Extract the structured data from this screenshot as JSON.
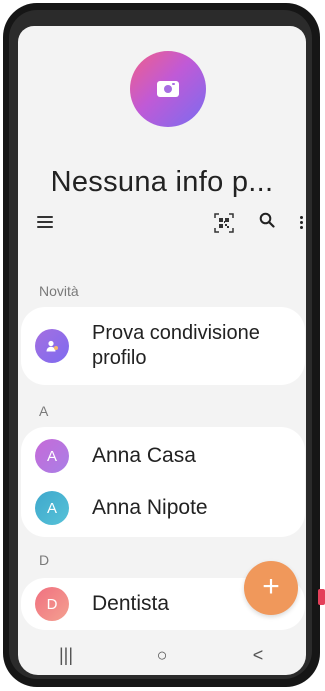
{
  "profile": {
    "title": "Nessuna info p..."
  },
  "toolbar": {
    "menu_icon": "menu-icon",
    "qr_icon": "qr-code-icon",
    "search_icon": "search-icon",
    "more_icon": "more-vertical-icon"
  },
  "sections": {
    "new": "Novità",
    "a": "A",
    "d": "D"
  },
  "share_card": {
    "label_line1": "Prova condivisione",
    "label_line2": "profilo"
  },
  "contacts": {
    "anna_casa": {
      "initial": "A",
      "name": "Anna Casa"
    },
    "anna_nipote": {
      "initial": "A",
      "name": "Anna Nipote"
    },
    "dentista": {
      "initial": "D",
      "name": "Dentista"
    }
  },
  "fab": {
    "label": "+"
  },
  "navbar": {
    "recents": "|||",
    "home": "○",
    "back": "<"
  },
  "colors": {
    "screen_bg": "#f3f3f3",
    "card_bg": "#ffffff",
    "fab": "#f0985b",
    "accent_pink": "#f05f8a",
    "accent_purple": "#a76ee2"
  }
}
